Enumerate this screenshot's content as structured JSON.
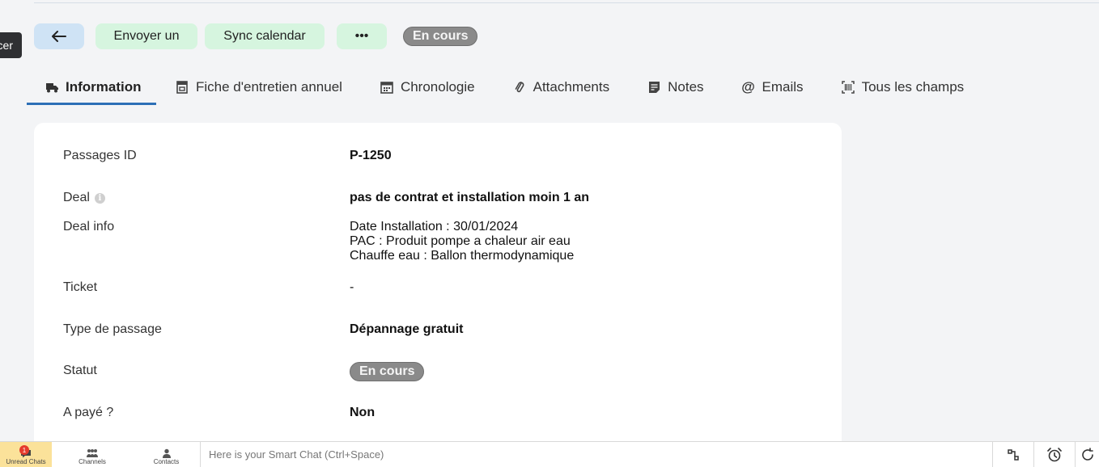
{
  "toolbar": {
    "back_icon": "arrow-left-icon",
    "send_label": "Envoyer un",
    "sync_label": "Sync calendar",
    "more_label": "•••",
    "status_pill": "En cours"
  },
  "left_tooltip": "Lancer",
  "tabs": [
    {
      "label": "Information",
      "icon": "truck-icon",
      "active": true
    },
    {
      "label": "Fiche d'entretien annuel",
      "icon": "archive-icon"
    },
    {
      "label": "Chronologie",
      "icon": "calendar-icon"
    },
    {
      "label": "Attachments",
      "icon": "paperclip-icon"
    },
    {
      "label": "Notes",
      "icon": "notes-icon"
    },
    {
      "label": "Emails",
      "icon": "at-icon"
    },
    {
      "label": "Tous les champs",
      "icon": "barcode-icon"
    }
  ],
  "fields": {
    "passages_id": {
      "label": "Passages ID",
      "value": "P-1250"
    },
    "deal": {
      "label": "Deal",
      "info": "i",
      "value": "pas de contrat et installation moin 1 an"
    },
    "deal_info": {
      "label": "Deal info",
      "lines": [
        "Date Installation : 30/01/2024",
        "PAC : Produit pompe a chaleur air eau",
        "Chauffe eau : Ballon thermodynamique"
      ]
    },
    "ticket": {
      "label": "Ticket",
      "value": "-"
    },
    "type_passage": {
      "label": "Type de passage",
      "value": "Dépannage gratuit"
    },
    "statut": {
      "label": "Statut",
      "value": "En cours"
    },
    "a_paye": {
      "label": "A payé ?",
      "value": "Non"
    }
  },
  "bottom_bar": {
    "unread_chats_label": "Unread Chats",
    "unread_count": "1",
    "channels_label": "Channels",
    "contacts_label": "Contacts",
    "chat_placeholder": "Here is your Smart Chat (Ctrl+Space)"
  }
}
